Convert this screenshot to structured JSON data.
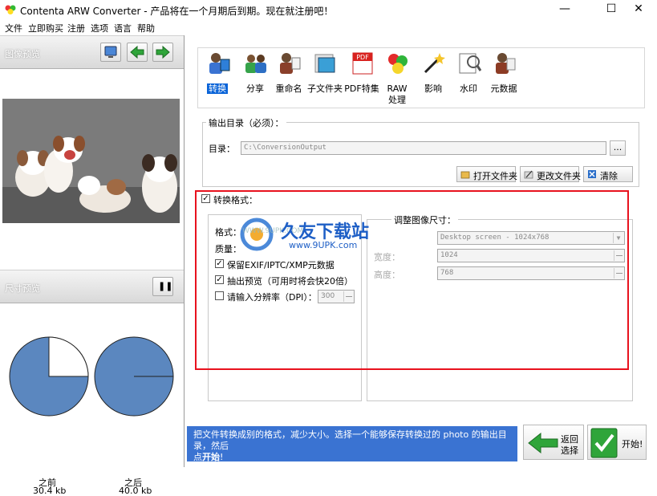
{
  "window": {
    "title": "Contenta ARW Converter  - 产品将在一个月期后到期。现在就注册吧！",
    "minimize": "—",
    "maximize": "☐",
    "close": "✕"
  },
  "menu": [
    "文件",
    "立即购买",
    "注册",
    "选项",
    "语言",
    "帮助"
  ],
  "left": {
    "preview_header": "图像预览",
    "size_header": "尺寸预览",
    "pause_glyph": "❚❚",
    "before_label": "之前",
    "before_size": "30.4 kb",
    "after_label": "之后",
    "after_size": "40.0 kb",
    "before_fraction": 0.25,
    "after_fraction": 0.0
  },
  "toolbar": [
    {
      "label": "转换",
      "icon": "convert-icon",
      "selected": true
    },
    {
      "label": "分享",
      "icon": "share-icon",
      "selected": false
    },
    {
      "label": "重命名",
      "icon": "rename-icon",
      "selected": false
    },
    {
      "label": "子文件夹",
      "icon": "subfolder-icon",
      "selected": false
    },
    {
      "label": "PDF特集",
      "icon": "pdf-icon",
      "selected": false
    },
    {
      "label": "RAW\n处理",
      "icon": "raw-icon",
      "selected": false
    },
    {
      "label": "影响",
      "icon": "effects-icon",
      "selected": false
    },
    {
      "label": "水印",
      "icon": "watermark-icon",
      "selected": false
    },
    {
      "label": "元数据",
      "icon": "metadata-icon",
      "selected": false
    }
  ],
  "output": {
    "group_title": "输出目录（必须）：",
    "dir_label": "目录：",
    "dir_value": "C:\\ConversionOutput",
    "browse": "...",
    "open_folder": "打开文件夹",
    "change_folder": "更改文件夹",
    "clear": "清除"
  },
  "convert": {
    "checkbox_label": "转换格式：",
    "format_label": "格式：",
    "quality_label": "质量：",
    "keep_meta_label": "保留EXIF/IPTC/XMP元数据",
    "extract_preview_label": "抽出预览（可用时将会快20倍）",
    "dpi_label": "请输入分辨率（DPI）：",
    "dpi_value": "300",
    "resize_title": "调整图像尺寸：",
    "preset_value": "Desktop screen - 1024x768",
    "width_label": "宽度：",
    "width_value": "1024",
    "height_label": "高度：",
    "height_value": "768"
  },
  "watermark": {
    "site_upper": "WWW.9UPK.COM",
    "brand": "久友下载站",
    "site_lower": "www.9UPK.com"
  },
  "bottom": {
    "info_line1": "把文件转换成别的格式，减少大小。选择一个能够保存转换过的 photo 的输出目录，然后",
    "info_line2_pre": "点",
    "info_line2_bold": "开始",
    "info_line2_post": "!",
    "back_line1": "返回",
    "back_line2": "选择",
    "start": "开始!"
  },
  "colors": {
    "accent": "#3a73d2",
    "selected": "#0a64d8",
    "highlight_frame": "#e8121e",
    "pie_fill": "#5b87bf"
  }
}
